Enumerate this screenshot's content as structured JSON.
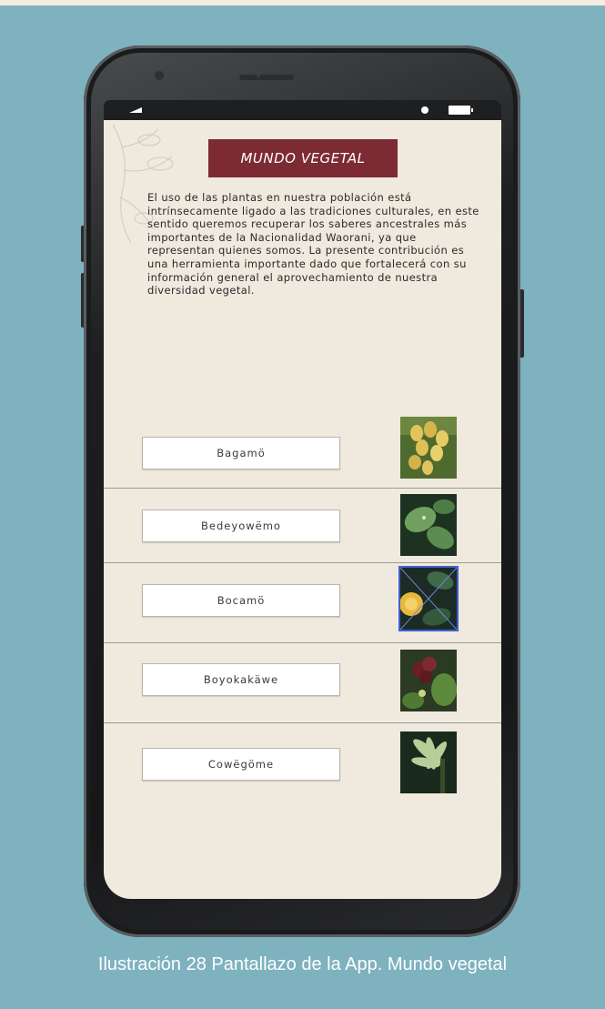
{
  "screen": {
    "title": "MUNDO VEGETAL",
    "intro_text": "El uso de las plantas en nuestra población está intrínsecamente ligado a las tradiciones culturales, en este sentido queremos recuperar los saberes ancestrales más importantes de la Nacionalidad Waorani, ya que representan quienes somos. La presente contribución es una herramienta importante dado que fortalecerá con su información general el aprovechamiento de nuestra diversidad vegetal.",
    "plants": [
      {
        "label": "Bagamö",
        "image": "yellow-fruit-cluster"
      },
      {
        "label": "Bedeyowëmo",
        "image": "green-leaves"
      },
      {
        "label": "Bocamö",
        "image": "citrus-fruit"
      },
      {
        "label": "Boyokakäwe",
        "image": "dark-red-fruit"
      },
      {
        "label": "Cowëgöme",
        "image": "palm-leaves"
      }
    ],
    "selected_plant": "Bocamö"
  },
  "caption": "Ilustración 28 Pantallazo de la App. Mundo vegetal",
  "colors": {
    "background": "#7eb2bf",
    "screen_bg": "#efe9de",
    "title_bg": "#7c2b33",
    "selection_outline": "#3d5fd0"
  }
}
